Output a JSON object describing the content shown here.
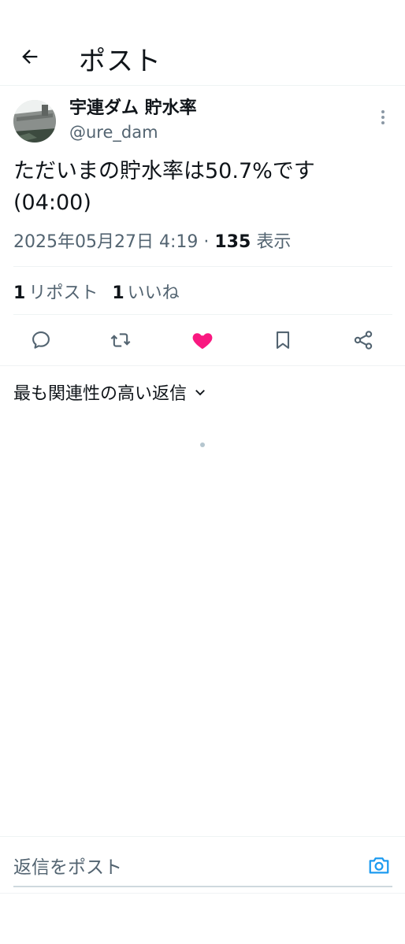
{
  "header": {
    "title": "ポスト",
    "back_icon": "arrow-left-icon"
  },
  "post": {
    "author": {
      "display_name": "宇連ダム 貯水率",
      "handle": "@ure_dam"
    },
    "text": "ただいまの貯水率は50.7%です\n(04:00)",
    "date": "2025年05月27日 4:19",
    "separator": "·",
    "views_count": "135",
    "views_label": "表示",
    "reposts_count": "1",
    "reposts_label": "リポスト",
    "likes_count": "1",
    "likes_label": "いいね",
    "liked": true,
    "like_color": "#f91880"
  },
  "actions": {
    "reply_icon": "comment-icon",
    "repost_icon": "repost-icon",
    "like_icon": "heart-icon",
    "bookmark_icon": "bookmark-icon",
    "share_icon": "share-icon"
  },
  "replies": {
    "sort_label": "最も関連性の高い返信"
  },
  "reply_bar": {
    "placeholder": "返信をポスト",
    "accent_color": "#1d9bf0"
  }
}
